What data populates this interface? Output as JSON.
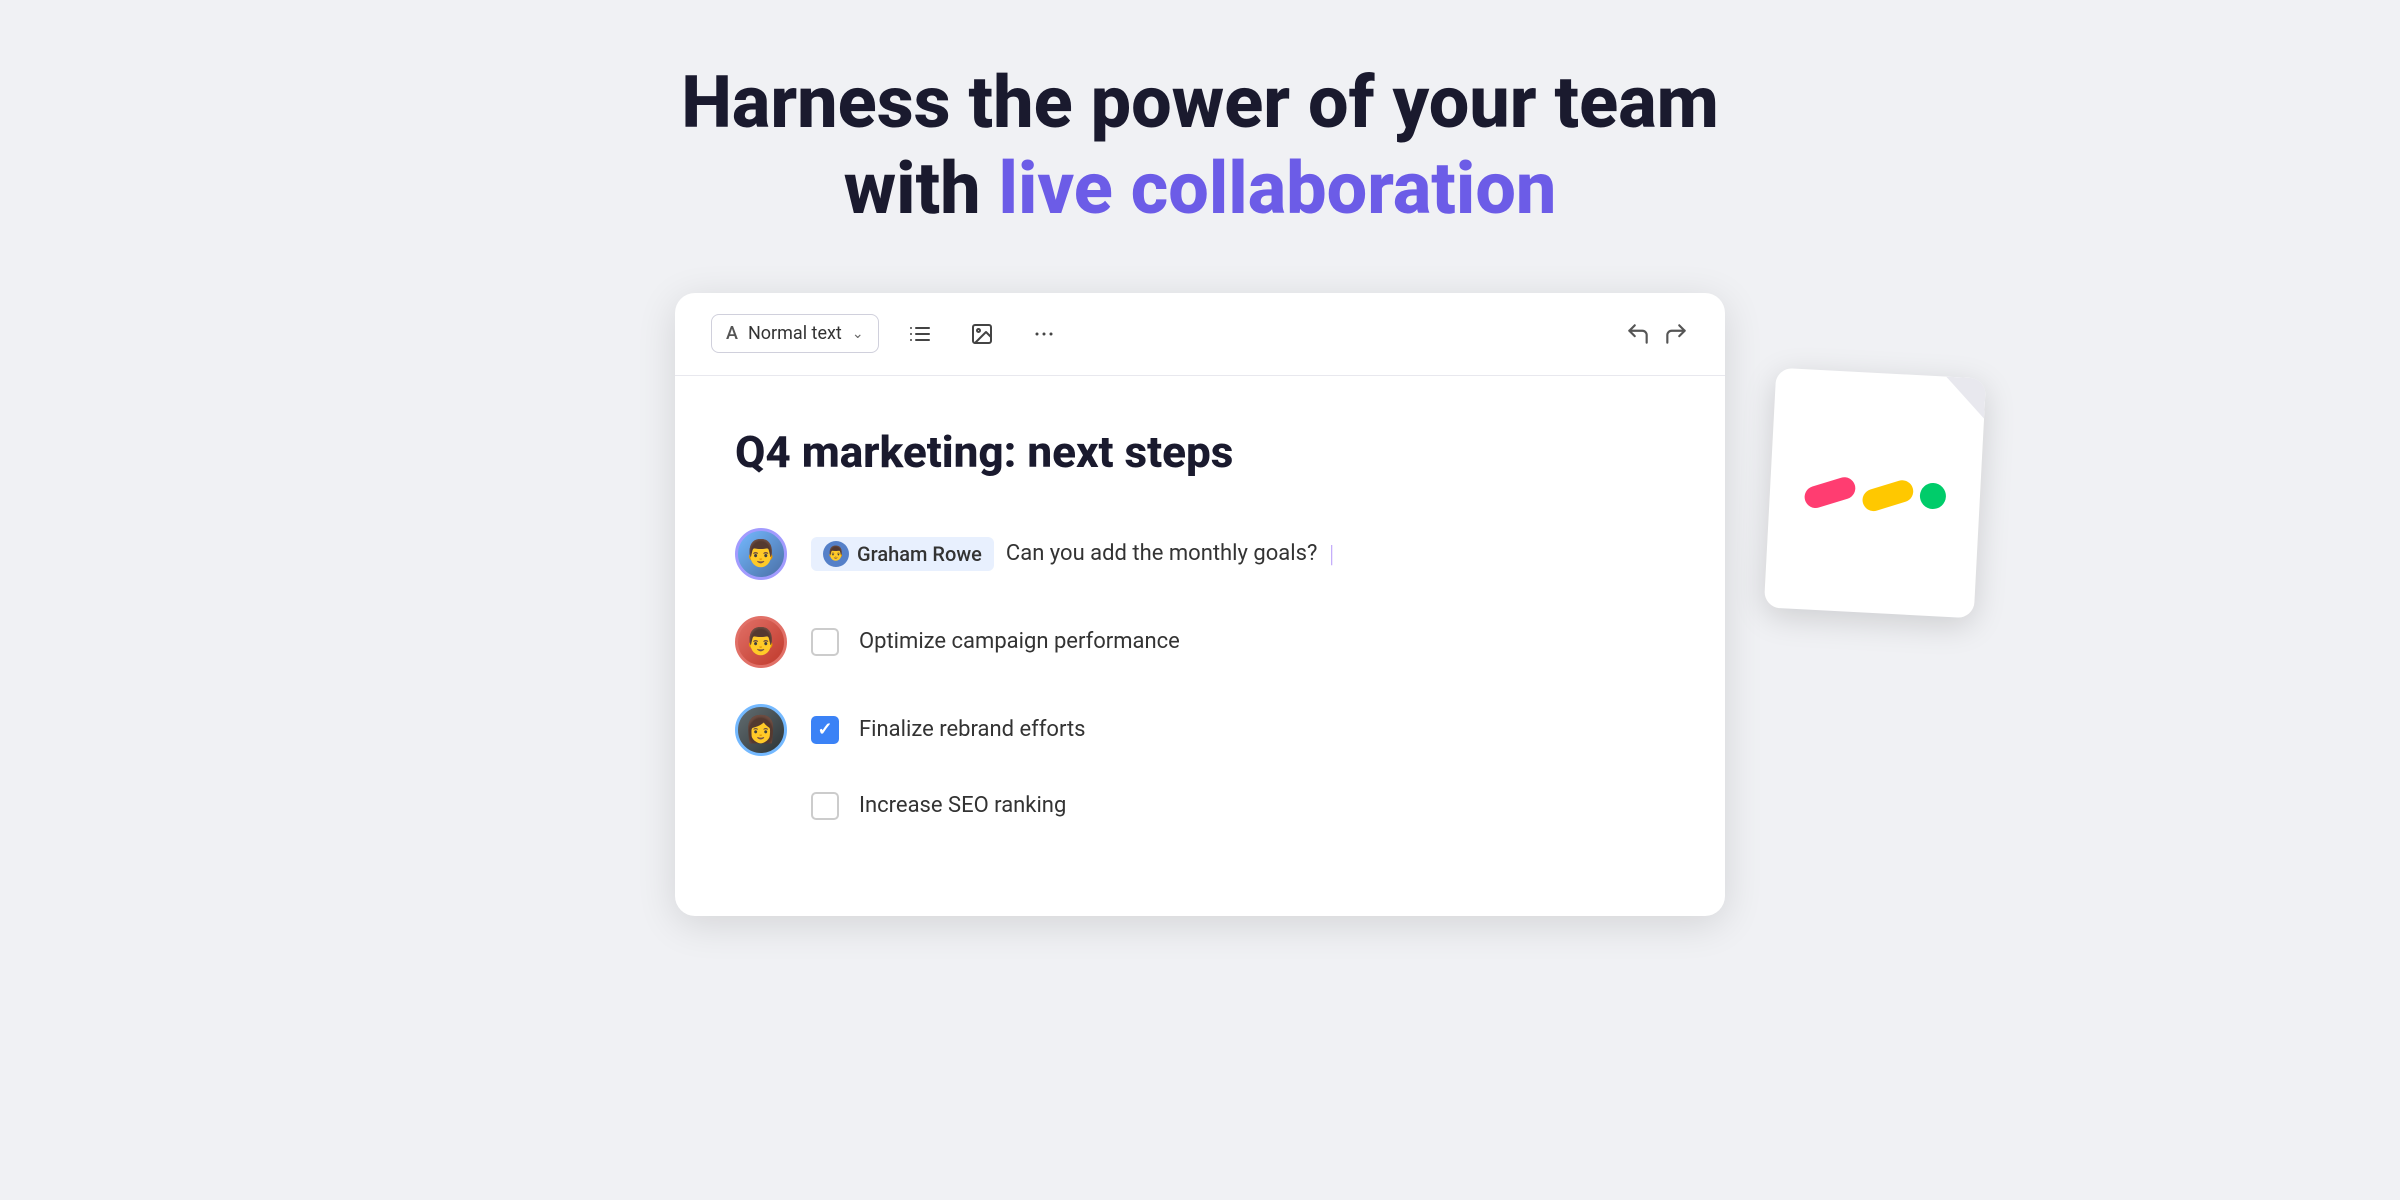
{
  "page": {
    "background_color": "#f0f1f4"
  },
  "headline": {
    "line1": "Harness the power of your team",
    "line2_prefix": "with ",
    "line2_highlight": "live collaboration",
    "highlight_color": "#6c5ce7"
  },
  "toolbar": {
    "text_style_prefix": "A",
    "text_style_label": "Normal text",
    "list_icon": "list-icon",
    "image_icon": "image-icon",
    "more_icon": "more-icon",
    "undo_icon": "undo-icon",
    "redo_icon": "redo-icon"
  },
  "document": {
    "title": "Q4 marketing: next steps"
  },
  "collab_row": {
    "mention_name": "Graham Rowe",
    "comment_text": "Can you add the monthly goals?",
    "cursor": "|"
  },
  "checklist": [
    {
      "id": 1,
      "text": "Optimize campaign performance",
      "checked": false
    },
    {
      "id": 2,
      "text": "Finalize rebrand efforts",
      "checked": true
    },
    {
      "id": 3,
      "text": "Increase SEO ranking",
      "checked": false
    }
  ],
  "avatars": [
    {
      "id": "avatar1",
      "border_color": "#a29bfe",
      "emoji": "👤"
    },
    {
      "id": "avatar2",
      "border_color": "#e17067",
      "emoji": "👤"
    },
    {
      "id": "avatar3",
      "border_color": "#74b9ff",
      "emoji": "👤"
    }
  ]
}
